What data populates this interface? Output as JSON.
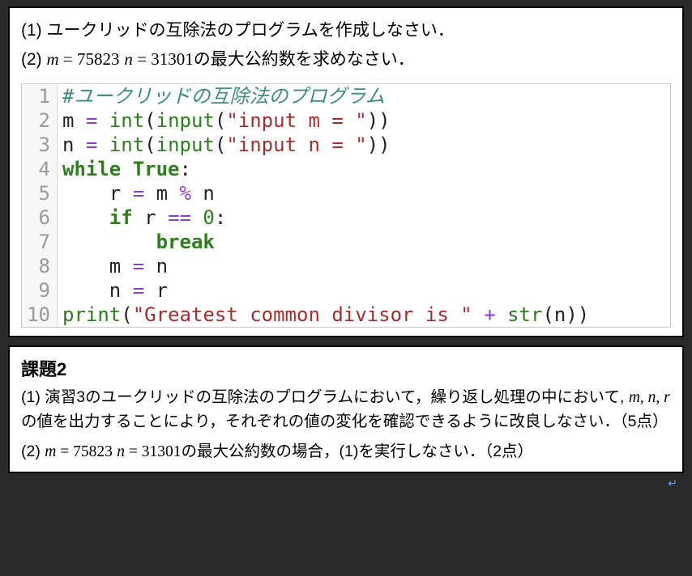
{
  "panel1": {
    "q1_prefix": "(1) ",
    "q1_text": "ユークリッドの互除法のプログラムを作成しなさい．",
    "q2_prefix": "(2)  ",
    "q2_m_var": "m",
    "q2_eq1": " = ",
    "q2_m_val": "75823",
    "q2_sep": " ",
    "q2_n_var": "n",
    "q2_eq2": " = ",
    "q2_n_val": "31301",
    "q2_tail": "の最大公約数を求めなさい．",
    "newline_glyph": "↵"
  },
  "code": {
    "lines": [
      {
        "n": "1",
        "seg": [
          {
            "c": "tok-comment",
            "t": "#ユークリッドの互除法のプログラム"
          }
        ]
      },
      {
        "n": "2",
        "seg": [
          {
            "c": "tok-plain",
            "t": "m "
          },
          {
            "c": "tok-op",
            "t": "="
          },
          {
            "c": "tok-plain",
            "t": " "
          },
          {
            "c": "tok-builtin",
            "t": "int"
          },
          {
            "c": "tok-plain",
            "t": "("
          },
          {
            "c": "tok-builtin",
            "t": "input"
          },
          {
            "c": "tok-plain",
            "t": "("
          },
          {
            "c": "tok-str",
            "t": "\"input m = \""
          },
          {
            "c": "tok-plain",
            "t": "))"
          }
        ]
      },
      {
        "n": "3",
        "seg": [
          {
            "c": "tok-plain",
            "t": "n "
          },
          {
            "c": "tok-op",
            "t": "="
          },
          {
            "c": "tok-plain",
            "t": " "
          },
          {
            "c": "tok-builtin",
            "t": "int"
          },
          {
            "c": "tok-plain",
            "t": "("
          },
          {
            "c": "tok-builtin",
            "t": "input"
          },
          {
            "c": "tok-plain",
            "t": "("
          },
          {
            "c": "tok-str",
            "t": "\"input n = \""
          },
          {
            "c": "tok-plain",
            "t": "))"
          }
        ]
      },
      {
        "n": "4",
        "seg": [
          {
            "c": "tok-kw",
            "t": "while"
          },
          {
            "c": "tok-plain",
            "t": " "
          },
          {
            "c": "tok-kw",
            "t": "True"
          },
          {
            "c": "tok-plain",
            "t": ":"
          }
        ]
      },
      {
        "n": "5",
        "seg": [
          {
            "c": "tok-plain",
            "t": "    r "
          },
          {
            "c": "tok-op",
            "t": "="
          },
          {
            "c": "tok-plain",
            "t": " m "
          },
          {
            "c": "tok-op",
            "t": "%"
          },
          {
            "c": "tok-plain",
            "t": " n"
          }
        ]
      },
      {
        "n": "6",
        "seg": [
          {
            "c": "tok-plain",
            "t": "    "
          },
          {
            "c": "tok-kw",
            "t": "if"
          },
          {
            "c": "tok-plain",
            "t": " r "
          },
          {
            "c": "tok-op",
            "t": "=="
          },
          {
            "c": "tok-plain",
            "t": " "
          },
          {
            "c": "tok-num",
            "t": "0"
          },
          {
            "c": "tok-plain",
            "t": ":"
          }
        ]
      },
      {
        "n": "7",
        "seg": [
          {
            "c": "tok-plain",
            "t": "        "
          },
          {
            "c": "tok-kw",
            "t": "break"
          }
        ]
      },
      {
        "n": "8",
        "seg": [
          {
            "c": "tok-plain",
            "t": "    m "
          },
          {
            "c": "tok-op",
            "t": "="
          },
          {
            "c": "tok-plain",
            "t": " n"
          }
        ]
      },
      {
        "n": "9",
        "seg": [
          {
            "c": "tok-plain",
            "t": "    n "
          },
          {
            "c": "tok-op",
            "t": "="
          },
          {
            "c": "tok-plain",
            "t": " r"
          }
        ]
      },
      {
        "n": "10",
        "seg": [
          {
            "c": "tok-builtin",
            "t": "print"
          },
          {
            "c": "tok-plain",
            "t": "("
          },
          {
            "c": "tok-str",
            "t": "\"Greatest common divisor is \""
          },
          {
            "c": "tok-plain",
            "t": " "
          },
          {
            "c": "tok-op",
            "t": "+"
          },
          {
            "c": "tok-plain",
            "t": " "
          },
          {
            "c": "tok-builtin",
            "t": "str"
          },
          {
            "c": "tok-plain",
            "t": "(n))"
          }
        ]
      }
    ]
  },
  "panel2": {
    "heading": "課題2",
    "p1_pre": "(1) 演習3のユークリッドの互除法のプログラムにおいて，繰り返し処理の中において, ",
    "p1_vars": "m, n, r",
    "p1_post": " の値を出力することにより，それぞれの値の変化を確認できるように改良しなさい．（5点）",
    "p2_prefix": "(2)  ",
    "p2_m_var": "m",
    "p2_eq1": " = ",
    "p2_m_val": "75823",
    "p2_sep": " ",
    "p2_n_var": "n",
    "p2_eq2": " = ",
    "p2_n_val": "31301",
    "p2_tail": "の最大公約数の場合，(1)を実行しなさい．（2点）",
    "newline_glyph": "↵"
  }
}
